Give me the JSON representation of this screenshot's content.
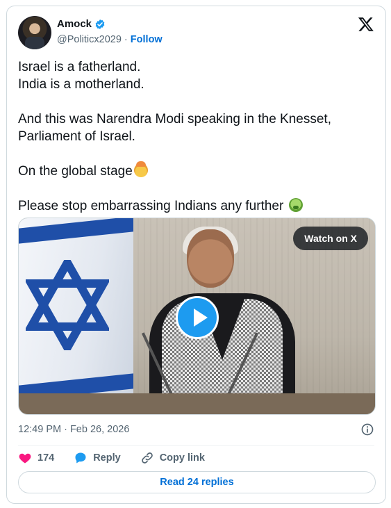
{
  "author": {
    "name": "Amock",
    "handle": "@Politicx2029",
    "separator": " · ",
    "follow_label": "Follow"
  },
  "tweet": {
    "line1": "Israel is a fatherland.",
    "line2": "India is a motherland.",
    "line3": "And this was Narendra Modi speaking in the Knesset,",
    "line4": "Parliament of Israel.",
    "line5": "On the global stage",
    "line6": "Please stop embarrassing Indians any further "
  },
  "media": {
    "watch_label": "Watch on X"
  },
  "meta": {
    "timestamp": "12:49 PM · Feb 26, 2026"
  },
  "actions": {
    "like_count": "174",
    "reply_label": "Reply",
    "copy_label": "Copy link"
  },
  "footer": {
    "read_replies": "Read 24 replies"
  },
  "colors": {
    "accent": "#006fd6",
    "like": "#f91880",
    "verified": "#1d9bf0"
  },
  "icons": [
    "verified-badge-icon",
    "x-logo-icon",
    "play-icon",
    "info-icon",
    "heart-icon",
    "reply-bubble-icon",
    "link-icon",
    "exploding-head-emoji",
    "nauseated-face-emoji"
  ]
}
